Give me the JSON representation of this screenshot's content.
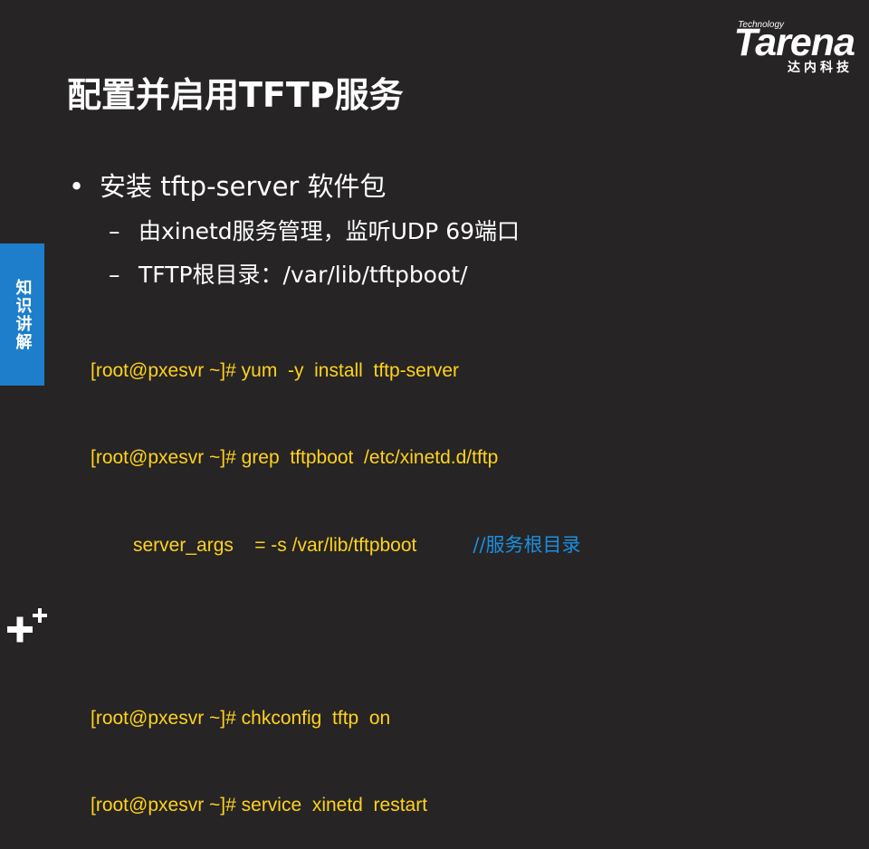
{
  "logo": {
    "tech": "Technology",
    "name": "Tarena",
    "cn": "达内科技"
  },
  "title": "配置并启用TFTP服务",
  "side_tab": "知识讲解",
  "bullet": "安装 tftp-server 软件包",
  "bullet_marker": "•",
  "sub_items": [
    {
      "marker": "–",
      "text": "由xinetd服务管理，监听UDP 69端口"
    },
    {
      "marker": "–",
      "text": "TFTP根目录：/var/lib/tftpboot/"
    }
  ],
  "code_lines": [
    "[root@pxesvr ~]# yum  -y  install  tftp-server",
    "[root@pxesvr ~]# grep  tftpboot  /etc/xinetd.d/tftp",
    "server_args    = -s /var/lib/tftpboot",
    "",
    "[root@pxesvr ~]# chkconfig  tftp  on",
    "[root@pxesvr ~]# service  xinetd  restart"
  ],
  "code_comment": "//服务根目录",
  "colors": {
    "background": "#262424",
    "code": "#ffd21e",
    "comment": "#1b8fe0",
    "side_tab": "#1e7ecb"
  },
  "icons": {
    "corner": "plus-plus-icon"
  }
}
